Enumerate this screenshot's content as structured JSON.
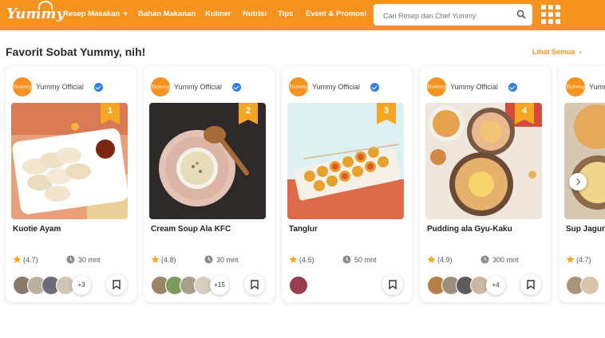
{
  "header": {
    "logo_text": "Yummy",
    "nav": [
      {
        "label": "Resep Masakan"
      },
      {
        "label": "Bahan Makanan"
      },
      {
        "label": "Kuliner"
      },
      {
        "label": "Nutrisi"
      },
      {
        "label": "Tips"
      },
      {
        "label": "Event & Promosi"
      }
    ],
    "search_placeholder": "Cari Resep dan Chef Yummy",
    "accent_color": "#f6921e"
  },
  "section": {
    "title": "Favorit Sobat Yummy, nih!",
    "see_all_label": "Lihat Semua"
  },
  "cards": [
    {
      "rank": "1",
      "author": "Yummy Official",
      "logo_text": "Yummy",
      "title": "Kuotie Ayam",
      "rating": "(4.7)",
      "time": "30 mnt",
      "extra": "+3"
    },
    {
      "rank": "2",
      "author": "Yummy Official",
      "logo_text": "Yummy",
      "title": "Cream Soup Ala KFC",
      "rating": "(4.8)",
      "time": "30 mnt",
      "extra": "+15"
    },
    {
      "rank": "3",
      "author": "Yummy Official",
      "logo_text": "Yummy",
      "title": "Tanglur",
      "rating": "(4.5)",
      "time": "50 mnt",
      "extra": ""
    },
    {
      "rank": "4",
      "author": "Yummy Official",
      "logo_text": "Yummy",
      "title": "Pudding ala Gyu-Kaku",
      "rating": "(4.9)",
      "time": "300 mnt",
      "extra": "+4"
    },
    {
      "rank": "",
      "author": "Yummy Official",
      "logo_text": "Yummy",
      "title": "Sup Jagung",
      "rating": "(4.7)",
      "time": "",
      "extra": ""
    }
  ]
}
